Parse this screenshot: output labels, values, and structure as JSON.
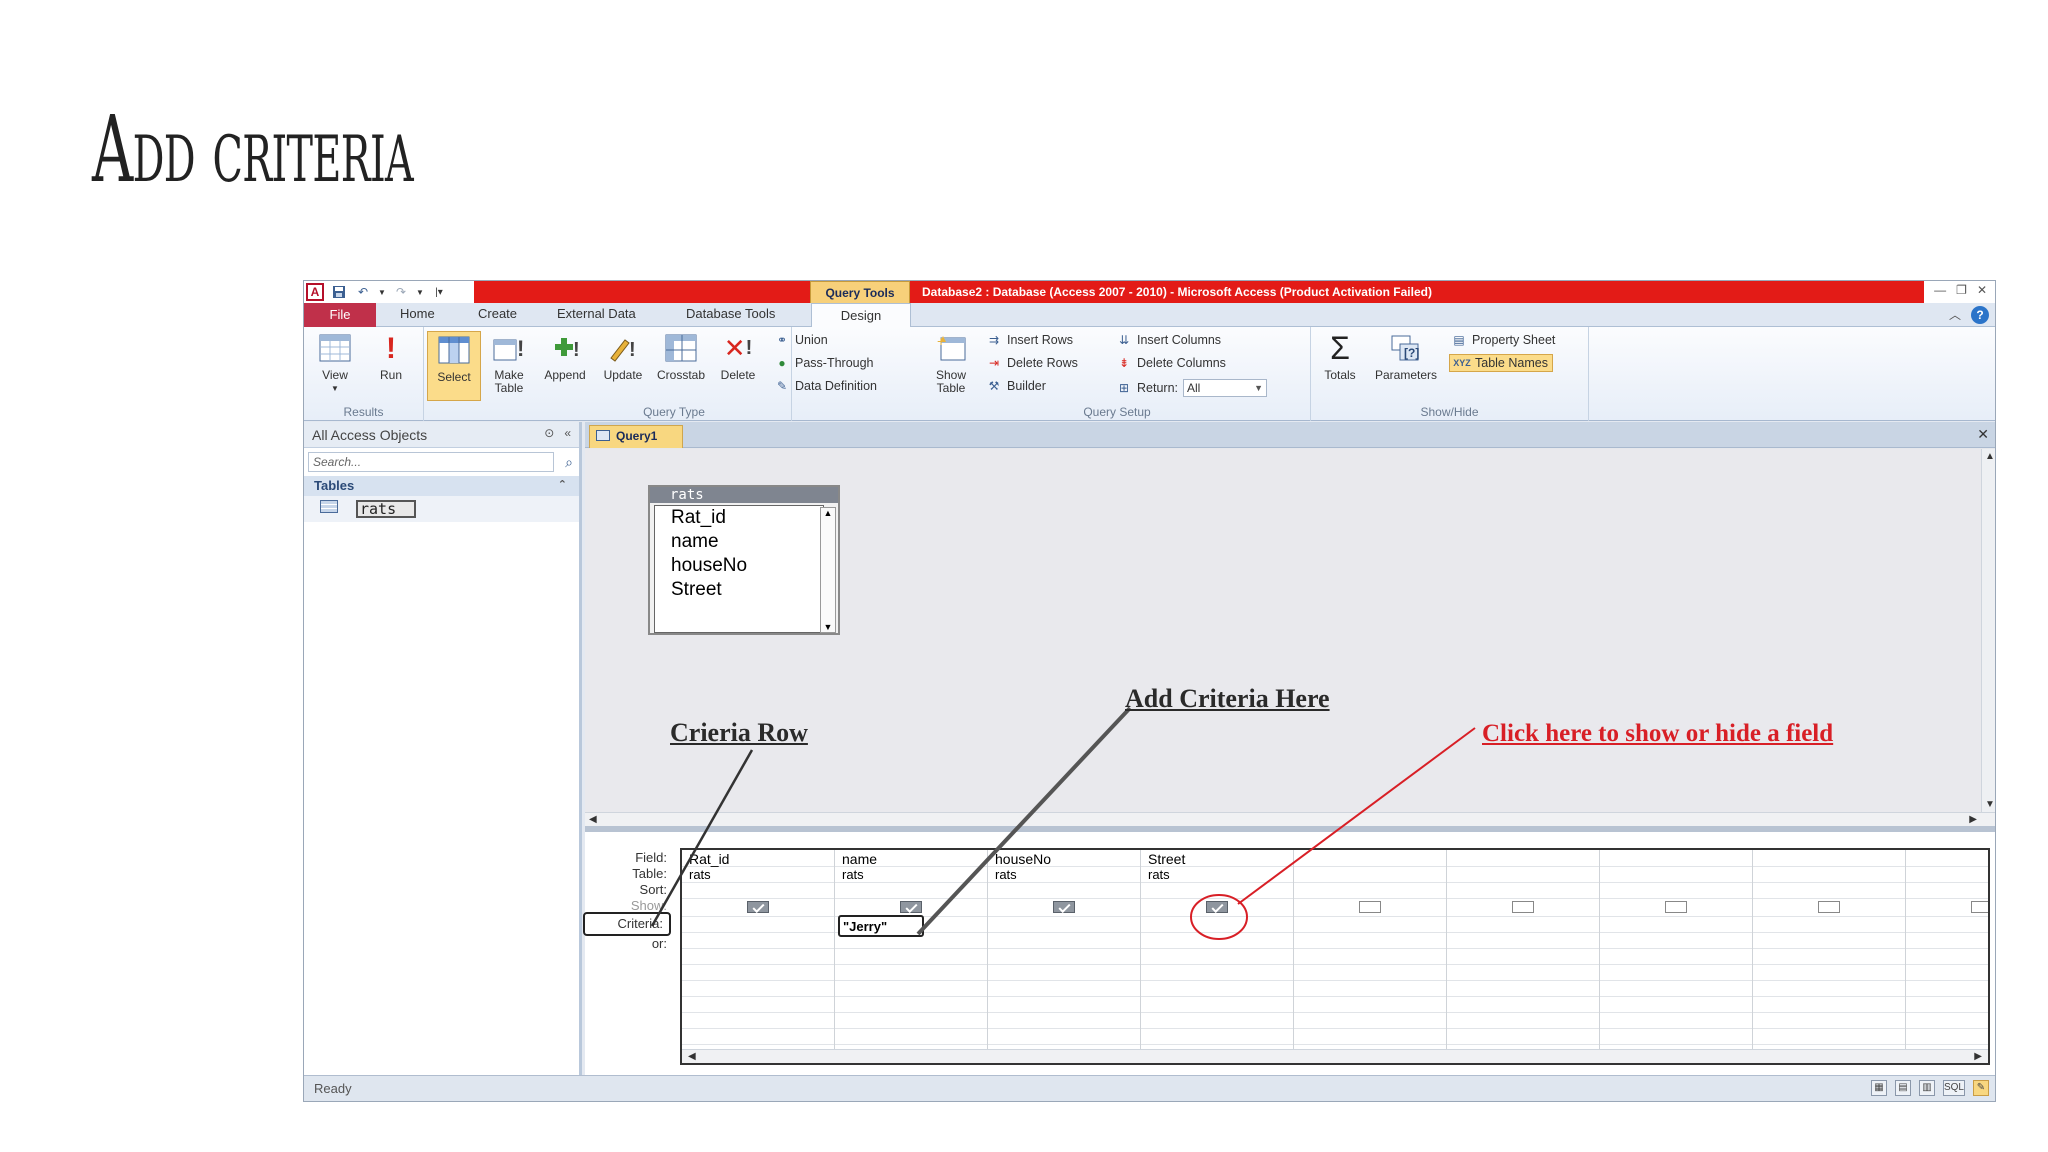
{
  "slide": {
    "title": "Add criteria"
  },
  "window": {
    "context_tab": "Query Tools",
    "title": "Database2 : Database (Access 2007 - 2010)  -  Microsoft Access (Product Activation Failed)",
    "logo": "A"
  },
  "tabs": {
    "file": "File",
    "items": [
      "Home",
      "Create",
      "External Data",
      "Database Tools"
    ],
    "design": "Design"
  },
  "ribbon": {
    "results": {
      "label": "Results",
      "view": "View",
      "run": "Run"
    },
    "query_type": {
      "label": "Query Type",
      "select": "Select",
      "make_table_1": "Make",
      "make_table_2": "Table",
      "append": "Append",
      "update": "Update",
      "crosstab": "Crosstab",
      "delete": "Delete",
      "union": "Union",
      "pass_through": "Pass-Through",
      "data_definition": "Data Definition"
    },
    "query_setup": {
      "label": "Query Setup",
      "show_table_1": "Show",
      "show_table_2": "Table",
      "insert_rows": "Insert Rows",
      "delete_rows": "Delete Rows",
      "builder": "Builder",
      "insert_columns": "Insert Columns",
      "delete_columns": "Delete Columns",
      "return_label": "Return:",
      "return_value": "All"
    },
    "show_hide": {
      "label": "Show/Hide",
      "totals": "Totals",
      "parameters": "Parameters",
      "property_sheet": "Property Sheet",
      "table_names": "Table Names"
    }
  },
  "nav": {
    "header": "All Access Objects",
    "search_placeholder": "Search...",
    "group": "Tables",
    "items": [
      "rats"
    ]
  },
  "document": {
    "tab": "Query1",
    "field_list": {
      "title": "rats",
      "fields": [
        "Rat_id",
        "name",
        "houseNo",
        "Street"
      ]
    },
    "row_labels": [
      "Field:",
      "Table:",
      "Sort:",
      "Show:",
      "Criteria:",
      "or:"
    ],
    "columns": [
      {
        "field": "Rat_id",
        "table": "rats",
        "show": true,
        "criteria": ""
      },
      {
        "field": "name",
        "table": "rats",
        "show": true,
        "criteria": "\"Jerry\""
      },
      {
        "field": "houseNo",
        "table": "rats",
        "show": true,
        "criteria": ""
      },
      {
        "field": "Street",
        "table": "rats",
        "show": true,
        "criteria": ""
      },
      {
        "field": "",
        "table": "",
        "show": false,
        "criteria": ""
      },
      {
        "field": "",
        "table": "",
        "show": false,
        "criteria": ""
      },
      {
        "field": "",
        "table": "",
        "show": false,
        "criteria": ""
      },
      {
        "field": "",
        "table": "",
        "show": false,
        "criteria": ""
      },
      {
        "field": "",
        "table": "",
        "show": false,
        "criteria": ""
      }
    ]
  },
  "status": {
    "text": "Ready",
    "views": [
      "SQL"
    ]
  },
  "annotations": {
    "criteria_row": "Crieria Row",
    "add_criteria_here": "Add Criteria Here",
    "show_hide_field": "Click here to show or hide a field"
  },
  "colors": {
    "title_bar": "#e31b17",
    "file_tab": "#c0304a",
    "context_tab": "#f7d07a",
    "annotation_red": "#d81f26"
  }
}
